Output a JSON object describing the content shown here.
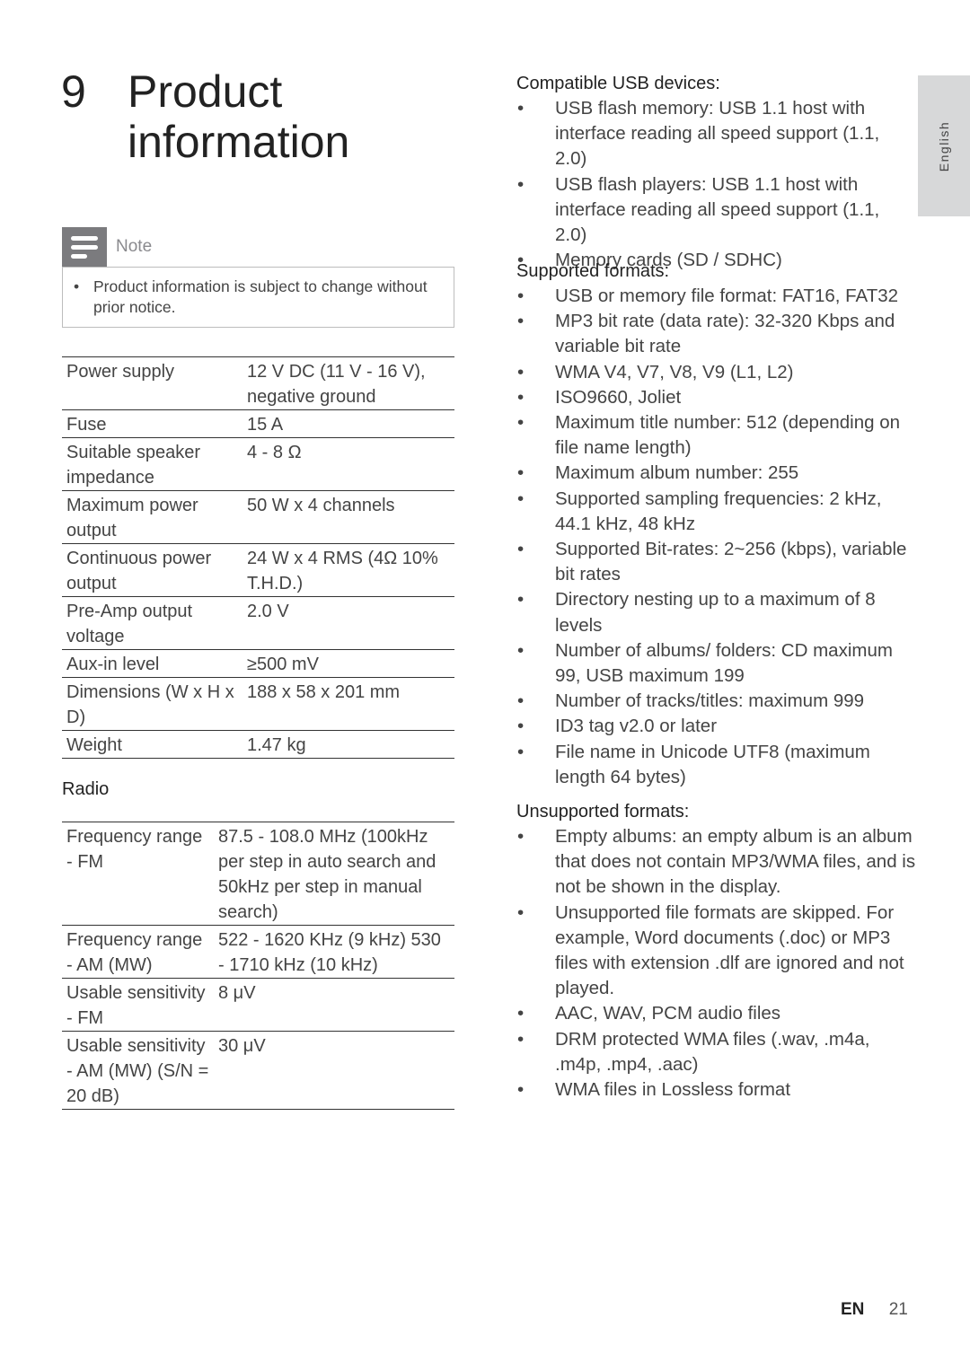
{
  "chapter": {
    "number": "9",
    "title": "Product information"
  },
  "note": {
    "icon": "note-lines-icon",
    "label": "Note",
    "items": [
      "Product information is subject to change without prior notice."
    ]
  },
  "general_specs": [
    {
      "label": "Power supply",
      "value": "12 V DC (11 V - 16 V), negative ground"
    },
    {
      "label": "Fuse",
      "value": "15 A"
    },
    {
      "label": "Suitable speaker impedance",
      "value": "4 - 8 Ω"
    },
    {
      "label": "Maximum power output",
      "value": "50 W x 4 channels"
    },
    {
      "label": "Continuous power output",
      "value": "24 W x 4 RMS (4Ω 10% T.H.D.)"
    },
    {
      "label": "Pre-Amp output voltage",
      "value": "2.0 V"
    },
    {
      "label": "Aux-in level",
      "value": "≥500 mV"
    },
    {
      "label": "Dimensions (W x H x D)",
      "value": "188 x 58 x 201 mm"
    },
    {
      "label": "Weight",
      "value": "1.47 kg"
    }
  ],
  "radio": {
    "heading": "Radio",
    "specs": [
      {
        "label": "Frequency range - FM",
        "value": "87.5 - 108.0 MHz (100kHz per step in auto search and 50kHz per step in manual search)"
      },
      {
        "label": "Frequency range - AM (MW)",
        "value": "522 - 1620 KHz (9 kHz) 530 - 1710 kHz (10 kHz)"
      },
      {
        "label": "Usable sensitivity - FM",
        "value": "8 μV"
      },
      {
        "label": "Usable sensitivity - AM (MW) (S/N = 20 dB)",
        "value": "30 μV"
      }
    ]
  },
  "compatible_usb": {
    "heading": "Compatible USB devices:",
    "items": [
      "USB flash memory: USB 1.1 host with interface reading all speed support (1.1, 2.0)",
      "USB flash players: USB 1.1 host with interface reading all speed support (1.1, 2.0)",
      "Memory cards (SD / SDHC)"
    ]
  },
  "supported_formats": {
    "heading": "Supported formats:",
    "items": [
      "USB or memory file format: FAT16, FAT32",
      "MP3 bit rate (data rate): 32-320 Kbps and variable bit rate",
      "WMA V4, V7, V8, V9 (L1, L2)",
      "ISO9660, Joliet",
      "Maximum title number: 512 (depending on file name length)",
      "Maximum album number: 255",
      "Supported sampling frequencies: 2 kHz, 44.1 kHz, 48 kHz",
      "Supported Bit-rates: 2~256 (kbps), variable bit rates",
      "Directory nesting up to a maximum of 8 levels",
      "Number of albums/ folders: CD maximum 99, USB maximum 199",
      "Number of tracks/titles: maximum 999",
      "ID3 tag v2.0 or later",
      "File name in Unicode UTF8 (maximum length 64 bytes)"
    ]
  },
  "unsupported_formats": {
    "heading": "Unsupported formats:",
    "items": [
      "Empty albums: an empty album is an album that does not contain MP3/WMA files, and is not be shown in the display.",
      "Unsupported file formats are skipped. For example, Word documents (.doc) or MP3 files with extension .dlf are ignored and not played.",
      "AAC, WAV, PCM audio files",
      "DRM protected WMA files (.wav, .m4a, .m4p, .mp4, .aac)",
      "WMA files in Lossless format"
    ]
  },
  "side_tab": {
    "label": "English"
  },
  "footer": {
    "lang": "EN",
    "page": "21"
  },
  "bullet": "•"
}
